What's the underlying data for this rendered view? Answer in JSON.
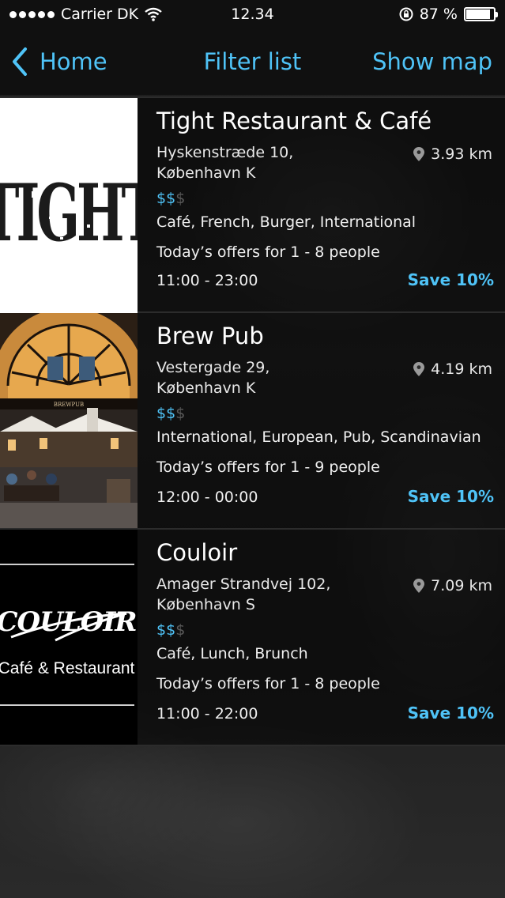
{
  "status_bar": {
    "carrier": "Carrier DK",
    "time": "12.34",
    "battery": "87 %",
    "battery_level": 0.87,
    "icons": [
      "signal-dots",
      "wifi-icon",
      "rotation-lock-icon",
      "battery-icon"
    ]
  },
  "nav": {
    "back_label": "Home",
    "title": "Filter list",
    "right_label": "Show map",
    "accent": "#4fc3f7"
  },
  "restaurants": [
    {
      "name": "Tight Restaurant & Café",
      "address_line1": "Hyskenstræde 10,",
      "address_line2": "København K",
      "distance": "3.93 km",
      "price_on": "$$",
      "price_off": "$",
      "cuisine": "Café, French, Burger, International",
      "offers": "Today’s offers for 1 - 8 people",
      "hours": "11:00 - 23:00",
      "save": "Save 10%",
      "logo_text": "TIGHT"
    },
    {
      "name": "Brew Pub",
      "address_line1": "Vestergade 29,",
      "address_line2": "København K",
      "distance": "4.19 km",
      "price_on": "$$",
      "price_off": "$",
      "cuisine": "International, European, Pub, Scandinavian",
      "offers": "Today’s offers for 1 - 9 people",
      "hours": "12:00 - 00:00",
      "save": "Save 10%",
      "sign_text": "BREWPUB"
    },
    {
      "name": "Couloir",
      "address_line1": "Amager Strandvej 102,",
      "address_line2": "København S",
      "distance": "7.09 km",
      "price_on": "$$",
      "price_off": "$",
      "cuisine": "Café, Lunch, Brunch",
      "offers": "Today’s offers for 1 - 8 people",
      "hours": "11:00 - 22:00",
      "save": "Save 10%",
      "logo_text": "COULOIR",
      "logo_subtitle": "Café & Restaurant"
    }
  ]
}
